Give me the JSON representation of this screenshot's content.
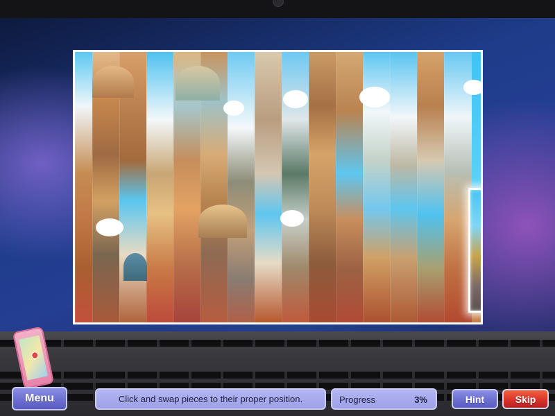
{
  "hud": {
    "menu_label": "Menu",
    "instruction": "Click and swap pieces to their proper position.",
    "progress_label": "Progress",
    "progress_value": "3%",
    "hint_label": "Hint",
    "skip_label": "Skip"
  },
  "puzzle": {
    "image_subject": "Rome skyline photo mosaic",
    "columns": 15,
    "selected_piece_column": 14
  },
  "icons": {
    "phone": "phone-map-icon"
  },
  "colors": {
    "button_purple": "#6e72d2",
    "skip_red": "#d8302a",
    "sky_blue": "#3fc4f2"
  }
}
